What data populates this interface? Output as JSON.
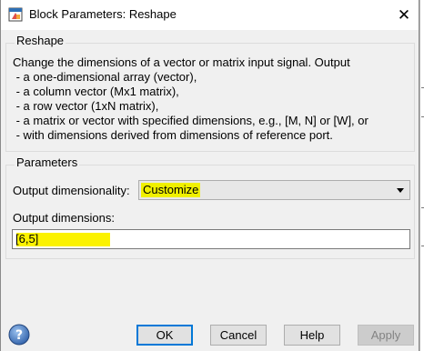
{
  "window": {
    "title": "Block Parameters: Reshape",
    "close_glyph": "✕"
  },
  "reshape_group": {
    "title": "Reshape",
    "description_lines": [
      "Change the dimensions of a vector or matrix input signal. Output",
      " - a one-dimensional array (vector),",
      " - a column vector (Mx1 matrix),",
      " - a row vector (1xN matrix),",
      " - a matrix or vector with specified dimensions, e.g., [M, N] or [W], or",
      " - with dimensions derived from dimensions of reference port."
    ]
  },
  "parameters_group": {
    "title": "Parameters",
    "output_dimensionality": {
      "label": "Output dimensionality:",
      "value": "Customize"
    },
    "output_dimensions": {
      "label": "Output dimensions:",
      "value": "[6,5]"
    }
  },
  "buttons": {
    "ok": "OK",
    "cancel": "Cancel",
    "help": "Help",
    "apply": "Apply"
  },
  "colors": {
    "highlight": "#f0f000",
    "default_button_border": "#0078d7",
    "dialog_bg": "#f0f0f0"
  },
  "icons": {
    "title": "simulink-block-icon",
    "help": "help-question-icon"
  }
}
